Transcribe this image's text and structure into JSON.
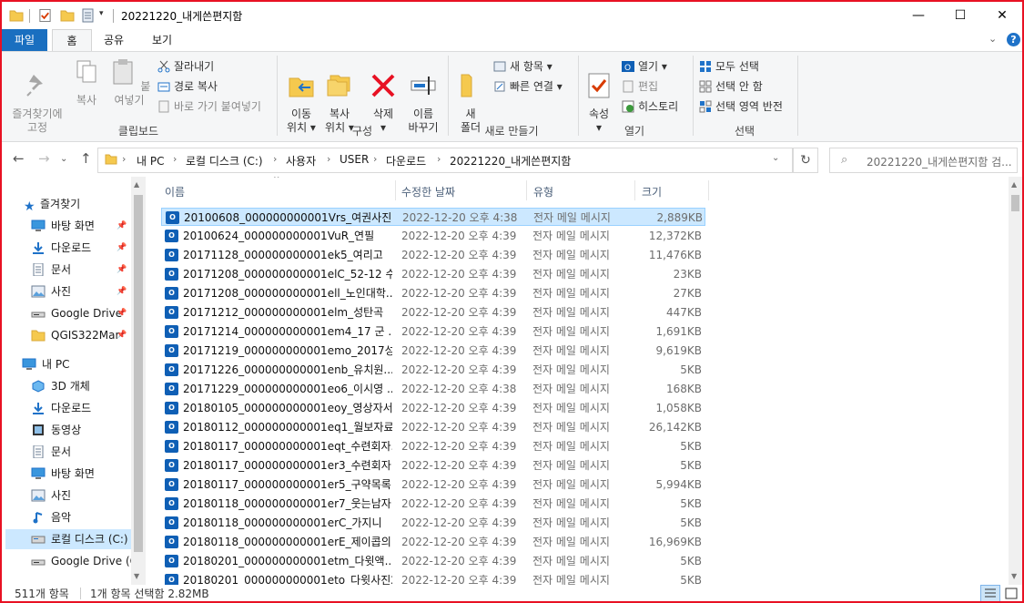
{
  "window": {
    "title": "20221220_내게쓴편지함",
    "minimize": "—",
    "maximize": "☐",
    "close": "✕"
  },
  "ribbon_tabs": {
    "file": "파일",
    "home": "홈",
    "share": "공유",
    "view": "보기"
  },
  "ribbon": {
    "clipboard": {
      "pin_quick": "즐겨찾기에\n고정",
      "copy": "복사",
      "paste": "붙여넣기",
      "cut": "잘라내기",
      "copy_path": "경로 복사",
      "paste_shortcut": "바로 가기 붙여넣기",
      "group_label": "클립보드"
    },
    "organize": {
      "move_to": "이동\n위치 ▾",
      "copy_to": "복사\n위치 ▾",
      "delete": "삭제\n▾",
      "rename": "이름\n바꾸기",
      "group_label": "구성"
    },
    "new": {
      "new_folder": "새\n폴더",
      "new_item": "새 항목 ▾",
      "easy_access": "빠른 연결 ▾",
      "group_label": "새로 만들기"
    },
    "open": {
      "properties": "속성\n▾",
      "open": "열기 ▾",
      "edit": "편집",
      "history": "히스토리",
      "group_label": "열기"
    },
    "select": {
      "select_all": "모두 선택",
      "select_none": "선택 안 함",
      "invert": "선택 영역 반전",
      "group_label": "선택"
    }
  },
  "address": {
    "segments": [
      "내 PC",
      "로컬 디스크 (C:)",
      "사용자",
      "USER",
      "다운로드",
      "20221220_내게쓴편지함"
    ],
    "search_placeholder": "20221220_내게쓴편지함 검..."
  },
  "nav": {
    "quick_access": "즐겨찾기",
    "items": [
      {
        "label": "바탕 화면",
        "icon": "desktop-icon",
        "pinned": true
      },
      {
        "label": "다운로드",
        "icon": "download-icon",
        "pinned": true
      },
      {
        "label": "문서",
        "icon": "document-icon",
        "pinned": true
      },
      {
        "label": "사진",
        "icon": "picture-icon",
        "pinned": true
      },
      {
        "label": "Google Drive",
        "icon": "drive-icon",
        "pinned": true
      },
      {
        "label": "QGIS322Mar",
        "icon": "folder-icon",
        "pinned": true
      }
    ],
    "this_pc": "내 PC",
    "pc_items": [
      {
        "label": "3D 개체",
        "icon": "3d-objects-icon"
      },
      {
        "label": "다운로드",
        "icon": "download-icon"
      },
      {
        "label": "동영상",
        "icon": "video-icon"
      },
      {
        "label": "문서",
        "icon": "document-icon"
      },
      {
        "label": "바탕 화면",
        "icon": "desktop-icon"
      },
      {
        "label": "사진",
        "icon": "picture-icon"
      },
      {
        "label": "음악",
        "icon": "music-icon"
      },
      {
        "label": "로컬 디스크 (C:)",
        "icon": "disk-icon",
        "selected": true
      },
      {
        "label": "Google Drive (G",
        "icon": "drive-icon"
      }
    ]
  },
  "columns": {
    "name": "이름",
    "modified": "수정한 날짜",
    "type": "유형",
    "size": "크기"
  },
  "files": [
    {
      "name": "20100608_000000000001Vrs_여권사진",
      "date": "2022-12-20 오후 4:38",
      "type": "전자 메일 메시지",
      "size": "2,889KB",
      "selected": true
    },
    {
      "name": "20100624_000000000001VuR_연필",
      "date": "2022-12-20 오후 4:39",
      "type": "전자 메일 메시지",
      "size": "12,372KB"
    },
    {
      "name": "20171128_000000000001ek5_여리고",
      "date": "2022-12-20 오후 4:39",
      "type": "전자 메일 메시지",
      "size": "11,476KB"
    },
    {
      "name": "20171208_000000000001elC_52-12 수...",
      "date": "2022-12-20 오후 4:39",
      "type": "전자 메일 메시지",
      "size": "23KB"
    },
    {
      "name": "20171208_000000000001ell_노인대학...",
      "date": "2022-12-20 오후 4:39",
      "type": "전자 메일 메시지",
      "size": "27KB"
    },
    {
      "name": "20171212_000000000001elm_성탄곡",
      "date": "2022-12-20 오후 4:39",
      "type": "전자 메일 메시지",
      "size": "447KB"
    },
    {
      "name": "20171214_000000000001em4_17 군 ...",
      "date": "2022-12-20 오후 4:39",
      "type": "전자 메일 메시지",
      "size": "1,691KB"
    },
    {
      "name": "20171219_000000000001emo_2017성...",
      "date": "2022-12-20 오후 4:39",
      "type": "전자 메일 메시지",
      "size": "9,619KB"
    },
    {
      "name": "20171226_000000000001enb_유치원...",
      "date": "2022-12-20 오후 4:39",
      "type": "전자 메일 메시지",
      "size": "5KB"
    },
    {
      "name": "20171229_000000000001eo6_이시영 ...",
      "date": "2022-12-20 오후 4:38",
      "type": "전자 메일 메시지",
      "size": "168KB"
    },
    {
      "name": "20180105_000000000001eoy_영상자서...",
      "date": "2022-12-20 오후 4:39",
      "type": "전자 메일 메시지",
      "size": "1,058KB"
    },
    {
      "name": "20180112_000000000001eq1_월보자료",
      "date": "2022-12-20 오후 4:39",
      "type": "전자 메일 메시지",
      "size": "26,142KB"
    },
    {
      "name": "20180117_000000000001eqt_수련회자...",
      "date": "2022-12-20 오후 4:39",
      "type": "전자 메일 메시지",
      "size": "5KB"
    },
    {
      "name": "20180117_000000000001er3_수련회자...",
      "date": "2022-12-20 오후 4:39",
      "type": "전자 메일 메시지",
      "size": "5KB"
    },
    {
      "name": "20180117_000000000001er5_구약목록...",
      "date": "2022-12-20 오후 4:39",
      "type": "전자 메일 메시지",
      "size": "5,994KB"
    },
    {
      "name": "20180118_000000000001er7_웃는남자...",
      "date": "2022-12-20 오후 4:39",
      "type": "전자 메일 메시지",
      "size": "5KB"
    },
    {
      "name": "20180118_000000000001erC_가지니",
      "date": "2022-12-20 오후 4:39",
      "type": "전자 메일 메시지",
      "size": "5KB"
    },
    {
      "name": "20180118_000000000001erE_제이콥의...",
      "date": "2022-12-20 오후 4:39",
      "type": "전자 메일 메시지",
      "size": "16,969KB"
    },
    {
      "name": "20180201_000000000001etm_다윗액...",
      "date": "2022-12-20 오후 4:39",
      "type": "전자 메일 메시지",
      "size": "5KB"
    },
    {
      "name": "20180201_000000000001eto_다윗사진2",
      "date": "2022-12-20 오후 4:39",
      "type": "전자 메일 메시지",
      "size": "5KB"
    }
  ],
  "status": {
    "count": "511개 항목",
    "selection": "1개 항목 선택함 2.82MB"
  },
  "colors": {
    "accent": "#1a6fc0",
    "selection": "#cce8ff",
    "frame_border": "#e81123"
  }
}
